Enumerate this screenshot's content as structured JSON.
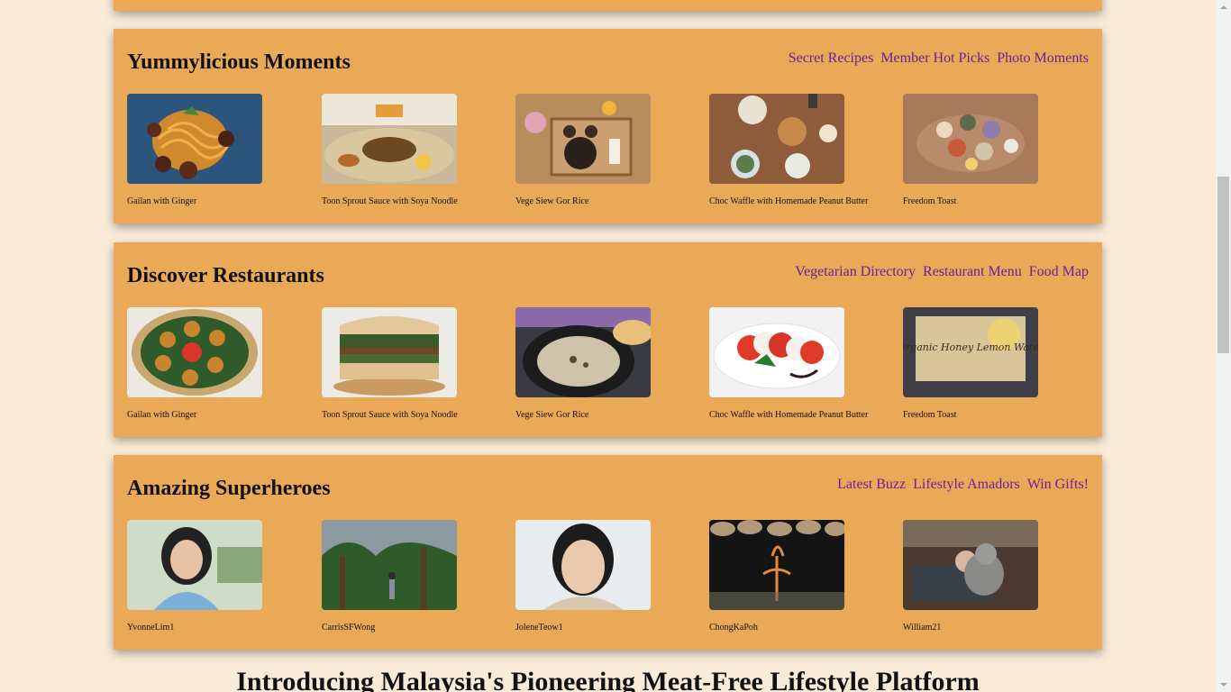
{
  "sections": [
    {
      "title": "Yummylicious Moments",
      "links": [
        "Secret Recipes",
        "Member Hot Picks",
        "Photo Moments"
      ],
      "items": [
        {
          "caption": "Gailan with Ginger",
          "icon": "spaghetti-meatballs-photo"
        },
        {
          "caption": "Toon Sprout Sauce with Soya Noodle",
          "icon": "noodle-soup-photo"
        },
        {
          "caption": "Vege Siew Gor Rice",
          "icon": "tray-meal-photo"
        },
        {
          "caption": "Choc Waffle with Homemade Peanut Butter",
          "icon": "table-spread-photo"
        },
        {
          "caption": "Freedom Toast",
          "icon": "table-dishes-photo"
        }
      ]
    },
    {
      "title": "Discover Restaurants",
      "links": [
        "Vegetarian Directory",
        "Restaurant Menu",
        "Food Map"
      ],
      "items": [
        {
          "caption": "Gailan with Ginger",
          "icon": "fritters-platter-photo"
        },
        {
          "caption": "Toon Sprout Sauce with Soya Noodle",
          "icon": "sandwich-photo"
        },
        {
          "caption": "Vege Siew Gor Rice",
          "icon": "mushroom-soup-photo"
        },
        {
          "caption": "Choc Waffle with Homemade Peanut Butter",
          "icon": "caprese-salad-photo"
        },
        {
          "caption": "Freedom Toast",
          "icon": "honey-lemon-water-poster"
        }
      ]
    },
    {
      "title": "Amazing Superheroes",
      "links": [
        "Latest Buzz",
        "Lifestyle Amadors",
        "Win Gifts!"
      ],
      "items": [
        {
          "caption": "YvonneLim1",
          "icon": "user-avatar-photo"
        },
        {
          "caption": "CarrisSFWong",
          "icon": "user-avatar-photo"
        },
        {
          "caption": "JoleneTeow1",
          "icon": "user-avatar-photo"
        },
        {
          "caption": "ChongKaPoh",
          "icon": "user-avatar-photo"
        },
        {
          "caption": "William21",
          "icon": "user-avatar-photo"
        }
      ]
    }
  ],
  "poster_text": "Organic Honey Lemon Water",
  "footer_title": "Introducing Malaysia's Pioneering Meat-Free Lifestyle Platform",
  "colors": {
    "page_bg": "#faebd9",
    "panel_bg": "#e9a956",
    "link": "#6b1f9b"
  }
}
